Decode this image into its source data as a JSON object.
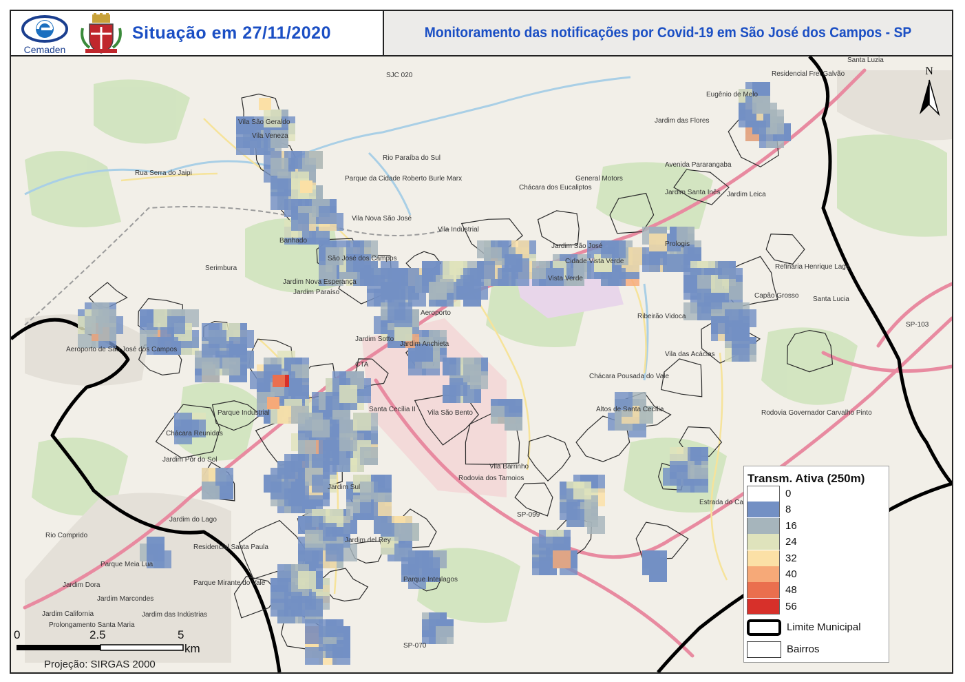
{
  "header": {
    "brand": "Cemaden",
    "situation_label": "Situação em 27/11/2020",
    "title": "Monitoramento das notificações por Covid-19 em São José dos Campos - SP"
  },
  "legend": {
    "title": "Transm. Ativa (250m)",
    "classes": [
      {
        "label": "0",
        "color": "#ffffff"
      },
      {
        "label": "8",
        "color": "#7390c4"
      },
      {
        "label": "16",
        "color": "#a6b5bc"
      },
      {
        "label": "24",
        "color": "#dfe3bc"
      },
      {
        "label": "32",
        "color": "#fbe0a6"
      },
      {
        "label": "40",
        "color": "#f6a978"
      },
      {
        "label": "48",
        "color": "#ea6f4e"
      },
      {
        "label": "56",
        "color": "#d7302a"
      }
    ],
    "boundary_label": "Limite Municipal",
    "neighborhoods_label": "Bairros"
  },
  "north_label": "N",
  "scale": {
    "ticks": [
      "0",
      "2.5",
      "5"
    ],
    "unit": "km"
  },
  "projection": "Projeção: SIRGAS 2000",
  "map_labels": [
    "Santa Luzia",
    "Residencial Frei Galvão",
    "Eugênio de Melo",
    "Jardim das Flores",
    "Vila São Geraldo",
    "Vila Veneza",
    "Parque da Cidade Roberto Burle Marx",
    "Chácara dos Eucaliptos",
    "General Motors",
    "Vila Industrial",
    "Vila Nova São José",
    "Banhado",
    "São José dos Campos",
    "Serimbura",
    "Jardim Nova Esperança",
    "Jardim Santa Inês",
    "Jardim Leica",
    "Jardim São José",
    "Cidade Vista Verde",
    "Vista Verde",
    "Refinaria Henrique Lage",
    "Capão Grosso",
    "Santa Lucia",
    "Prologis",
    "Jardim Paraíso",
    "Jardim Anchieta",
    "CTA",
    "Aeroporto",
    "Jardim Sotto",
    "Vila das Acácias",
    "Chácara Pousada do Vale",
    "Altos de Santa Cecília",
    "Santa Cecília II",
    "Vila São Bento",
    "Aeroporto de São José dos Campos",
    "Vila Barrinho",
    "Jardim do Lago",
    "Rio Comprido",
    "Parque Meia Lua",
    "Jardim Dora",
    "Jardim Marcondes",
    "Jardim California",
    "Prolongamento Santa Maria",
    "Jardim das Indústrias",
    "Parque Mirante do Vale",
    "Residencial Santa Paula",
    "Parque Interlagos",
    "Jardim del Rey",
    "Jardim Pôr do Sol",
    "SJC 020",
    "SP-099",
    "SP-070",
    "SP-103",
    "Jardim Sul",
    "Parque Industrial",
    "Chácara Reunidas",
    "Rua Serra do Jaipi",
    "Rodovia dos Tamoios",
    "Rodovia Governador Carvalho Pinto",
    "Avenida Pararangaba",
    "Rio Paraíba do Sul",
    "Ribeirão Vidoca",
    "Estrada do Capuava"
  ]
}
